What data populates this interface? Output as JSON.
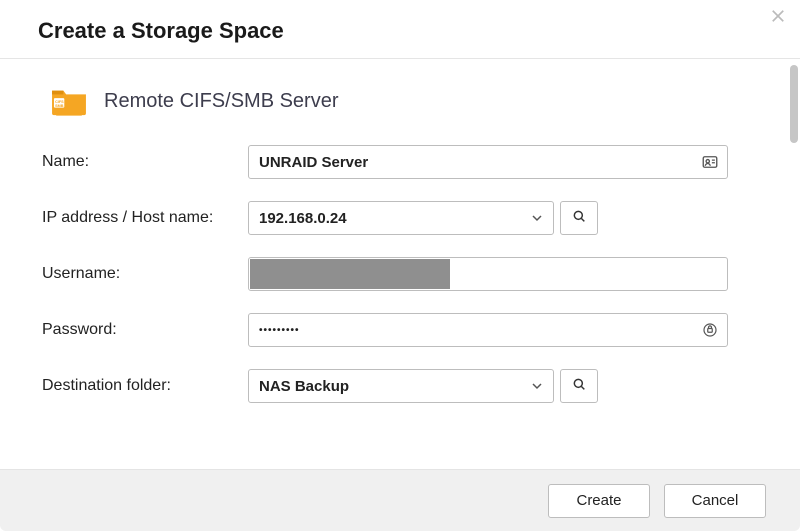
{
  "dialog": {
    "title": "Create a Storage Space"
  },
  "section": {
    "icon": "cifs-smb-folder-icon",
    "title": "Remote CIFS/SMB Server"
  },
  "form": {
    "name": {
      "label": "Name:",
      "value": "UNRAID Server"
    },
    "host": {
      "label": "IP address / Host name:",
      "value": "192.168.0.24"
    },
    "username": {
      "label": "Username:",
      "value": ""
    },
    "password": {
      "label": "Password:",
      "mask": "•••••••••"
    },
    "destination": {
      "label": "Destination folder:",
      "value": "NAS Backup"
    }
  },
  "footer": {
    "create": "Create",
    "cancel": "Cancel"
  }
}
